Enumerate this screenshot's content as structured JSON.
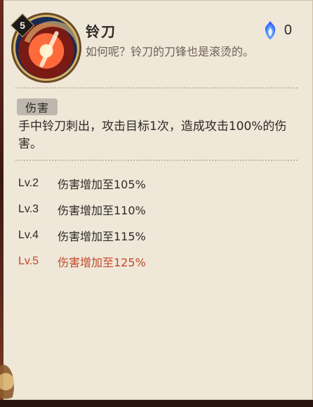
{
  "skill": {
    "level": "5",
    "name": "铃刀",
    "flavor_text": "如何呢？铃刀的刀锋也是滚烫的。",
    "soul_cost": "0"
  },
  "tag": {
    "label": "伤害"
  },
  "description": "手中铃刀刺出，攻击目标1次，造成攻击100%的伤害。",
  "levels": [
    {
      "lv": "Lv.2",
      "text": "伤害增加至105%",
      "highlight": false
    },
    {
      "lv": "Lv.3",
      "text": "伤害增加至110%",
      "highlight": false
    },
    {
      "lv": "Lv.4",
      "text": "伤害增加至115%",
      "highlight": false
    },
    {
      "lv": "Lv.5",
      "text": "伤害增加至125%",
      "highlight": true
    }
  ],
  "colors": {
    "panel_bg": "#efe7d8",
    "text_primary": "#2d2a26",
    "text_secondary": "#6d6356",
    "highlight": "#c04a28",
    "tag_bg": "#bdb7ad",
    "soul_flame": "#2a63ff"
  },
  "icons": {
    "skill": "skill-icon",
    "soul_cost": "soul-fire-icon"
  }
}
